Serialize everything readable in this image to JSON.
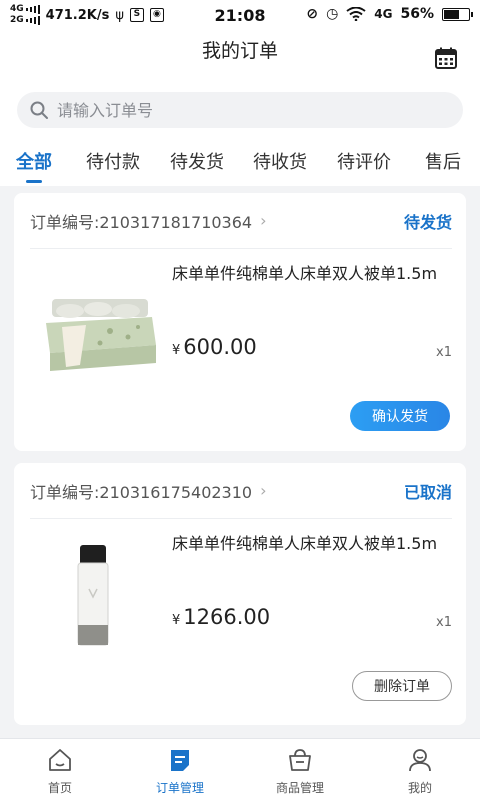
{
  "status_bar": {
    "network_top": "4G",
    "network_bottom": "2G",
    "speed": "471.2K/s",
    "time": "21:08",
    "net_type": "4G",
    "battery": "56%"
  },
  "header": {
    "title": "我的订单",
    "calendar_icon": "calendar-icon"
  },
  "search": {
    "placeholder": "请输入订单号",
    "value": ""
  },
  "tabs": [
    {
      "label": "全部",
      "active": true
    },
    {
      "label": "待付款",
      "active": false
    },
    {
      "label": "待发货",
      "active": false
    },
    {
      "label": "待收货",
      "active": false
    },
    {
      "label": "待评价",
      "active": false
    },
    {
      "label": "售后",
      "active": false
    }
  ],
  "orders": [
    {
      "order_no": "订单编号:210317181710364",
      "status": "待发货",
      "product_name": "床单单件纯棉单人床单双人被单1.5m",
      "currency": "¥",
      "price": "600.00",
      "qty": "x1",
      "action": "确认发货"
    },
    {
      "order_no": "订单编号:210316175402310",
      "status": "已取消",
      "product_name": "床单单件纯棉单人床单双人被单1.5m",
      "currency": "¥",
      "price": "1266.00",
      "qty": "x1",
      "action": "删除订单"
    }
  ],
  "bottom_nav": [
    {
      "label": "首页",
      "icon": "home-icon",
      "active": false
    },
    {
      "label": "订单管理",
      "icon": "order-icon",
      "active": true
    },
    {
      "label": "商品管理",
      "icon": "basket-icon",
      "active": false
    },
    {
      "label": "我的",
      "icon": "user-icon",
      "active": false
    }
  ],
  "colors": {
    "accent": "#1a73c9",
    "background": "#f2f3f5"
  }
}
